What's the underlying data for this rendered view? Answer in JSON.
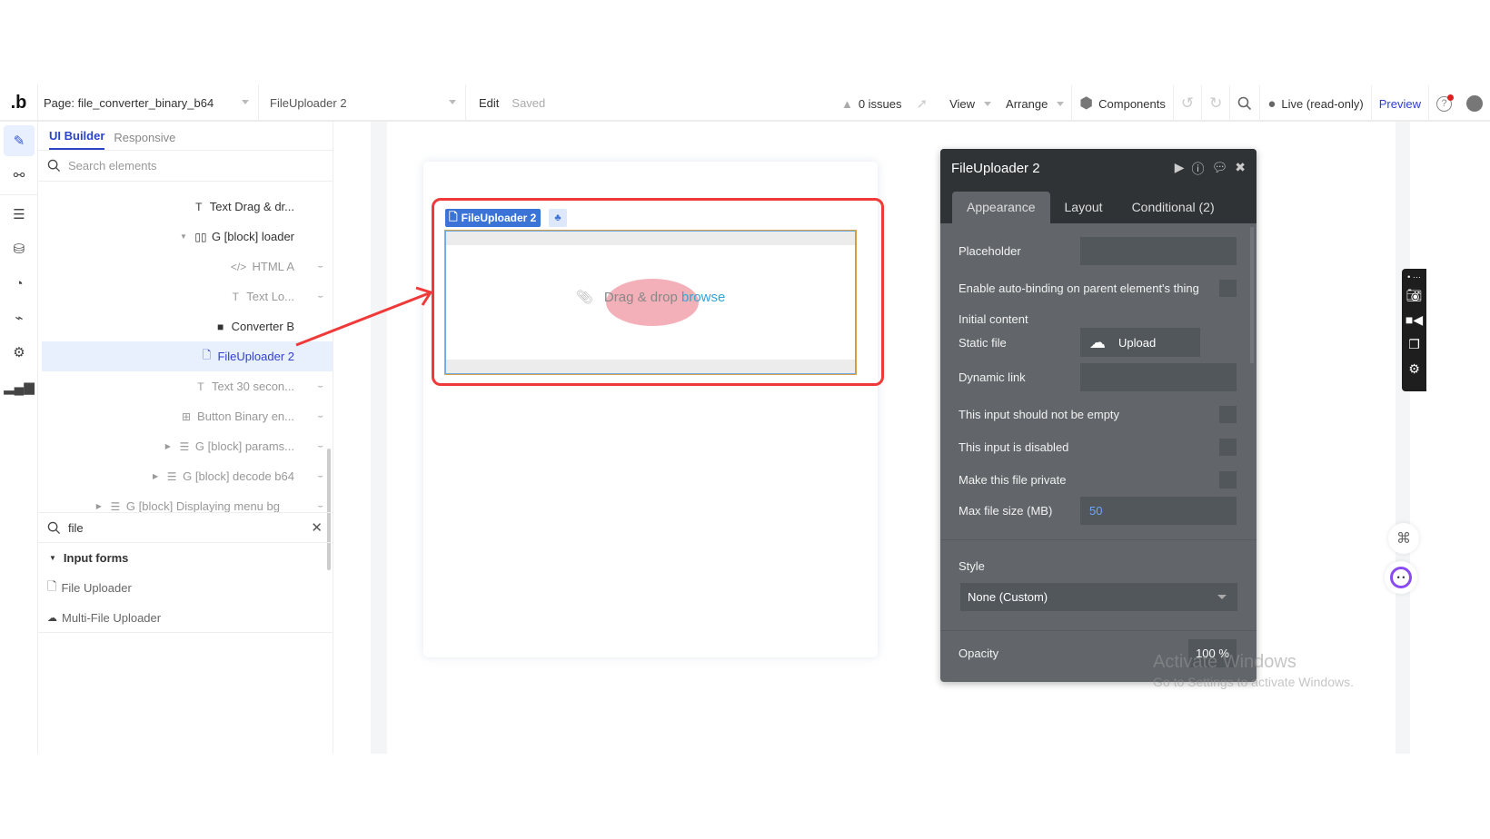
{
  "topbar": {
    "logo": ".b",
    "page_selector": "Page: file_converter_binary_b64",
    "element_selector": "FileUploader 2",
    "edit_label": "Edit",
    "saved_label": "Saved",
    "issues_label": "0 issues",
    "view_label": "View",
    "arrange_label": "Arrange",
    "components_label": "Components",
    "live_label": "Live (read-only)",
    "preview_label": "Preview"
  },
  "panel": {
    "tabs": [
      {
        "label": "UI Builder",
        "active": true
      },
      {
        "label": "Responsive",
        "active": false
      }
    ],
    "search_placeholder": "Search elements",
    "tree": [
      {
        "label": "Text Drag & dr...",
        "icon": "T",
        "hidden": false
      },
      {
        "label": "G [block] loader",
        "icon": "▯▯",
        "hidden": false,
        "expanded": true
      },
      {
        "label": "HTML A",
        "icon": "</>",
        "hidden": true
      },
      {
        "label": "Text Lo...",
        "icon": "T",
        "hidden": true
      },
      {
        "label": "Converter B",
        "icon": "■",
        "hidden": false
      },
      {
        "label": "FileUploader 2",
        "icon": "file-plus",
        "hidden": false,
        "selected": true
      },
      {
        "label": "Text 30 secon...",
        "icon": "T",
        "hidden": true
      },
      {
        "label": "Button Binary en...",
        "icon": "[+]",
        "hidden": true
      },
      {
        "label": "G [block] params...",
        "icon": "☰",
        "hidden": true,
        "collapsed": true
      },
      {
        "label": "G [block] decode b64",
        "icon": "☰",
        "hidden": true,
        "collapsed": true
      },
      {
        "label": "G [block] Displaying menu bg",
        "icon": "☰",
        "hidden": true,
        "collapsed": true
      }
    ],
    "element_search_value": "file",
    "category": "Input forms",
    "category_items": [
      {
        "label": "File Uploader",
        "icon": "file-plus-icon"
      },
      {
        "label": "Multi-File Uploader",
        "icon": "cloud-upload-icon"
      }
    ]
  },
  "canvas": {
    "element_tag": "FileUploader 2",
    "uploader_text": "Drag & drop",
    "uploader_link": "browse"
  },
  "property_editor": {
    "title": "FileUploader 2",
    "tabs": [
      {
        "label": "Appearance",
        "active": true
      },
      {
        "label": "Layout",
        "active": false
      },
      {
        "label": "Conditional (2)",
        "active": false
      }
    ],
    "placeholder_label": "Placeholder",
    "placeholder_value": "",
    "autobinding_label": "Enable auto-binding on parent element's thing",
    "initial_content_label": "Initial content",
    "static_file_label": "Static file",
    "upload_label": "Upload",
    "dynamic_link_label": "Dynamic link",
    "not_empty_label": "This input should not be empty",
    "disabled_label": "This input is disabled",
    "private_label": "Make this file private",
    "max_size_label": "Max file size (MB)",
    "max_size_value": "50",
    "style_label": "Style",
    "style_value": "None (Custom)",
    "opacity_label": "Opacity",
    "opacity_value": "100 %"
  },
  "watermark": {
    "line1": "Activate Windows",
    "line2": "Go to Settings to activate Windows."
  },
  "colors": {
    "accent": "#2b44c7",
    "highlight_red": "#f03a3a",
    "tag_blue": "#3b73d6",
    "panel_dark": "#62666a"
  }
}
